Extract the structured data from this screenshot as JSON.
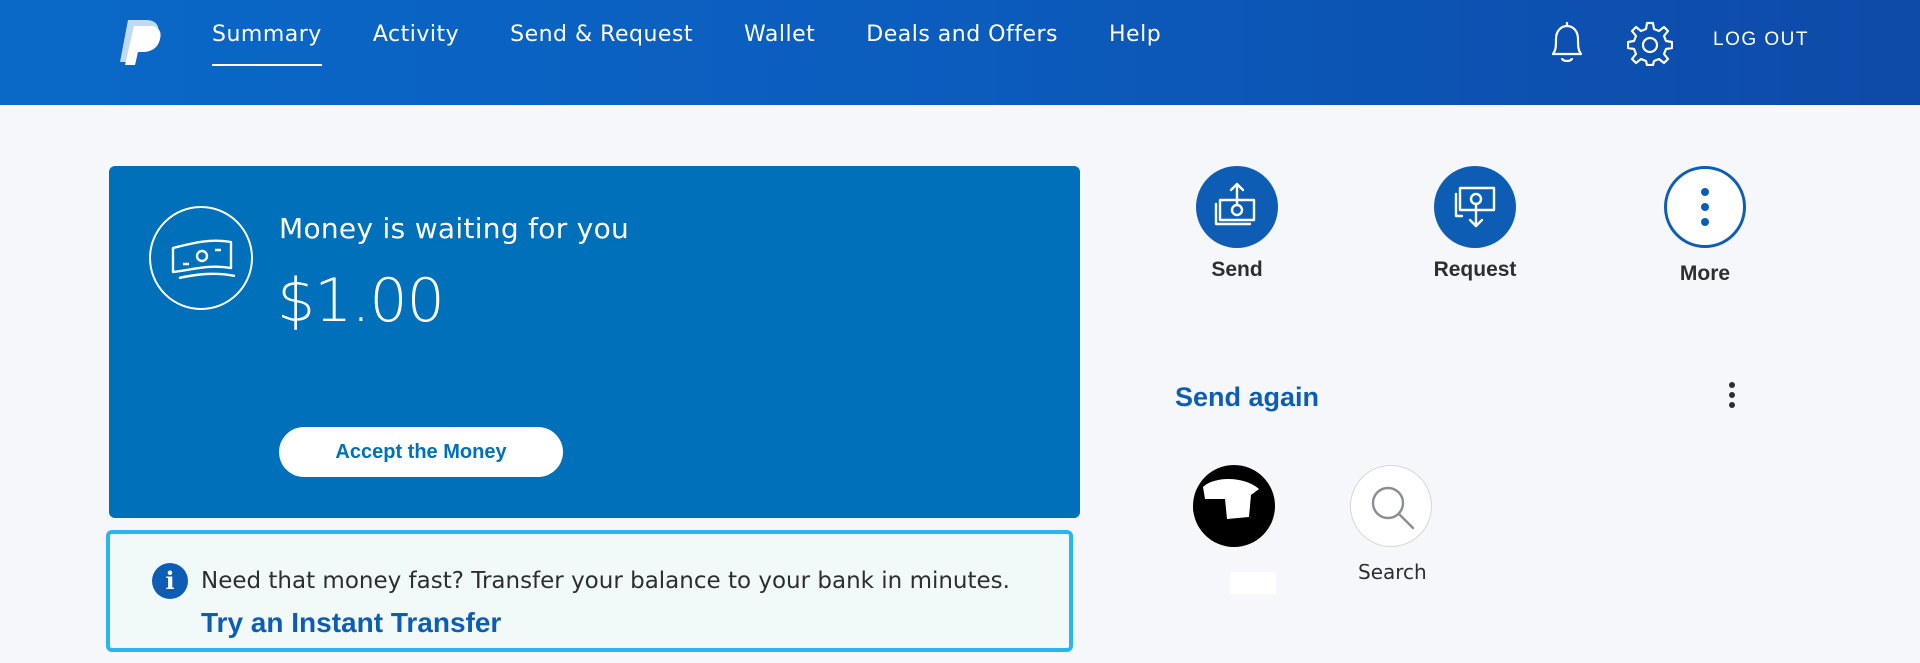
{
  "nav": {
    "items": [
      "Summary",
      "Activity",
      "Send & Request",
      "Wallet",
      "Deals and Offers",
      "Help"
    ],
    "active": "Summary",
    "logout_label": "LOG OUT"
  },
  "money_card": {
    "title": "Money is waiting for you",
    "amount": "$1.00",
    "accept_label": "Accept the Money"
  },
  "info_banner": {
    "message": "Need that money fast? Transfer your balance to your bank in minutes.",
    "link_label": "Try an Instant Transfer"
  },
  "actions": {
    "send_label": "Send",
    "request_label": "Request",
    "more_label": "More"
  },
  "send_again": {
    "title": "Send again",
    "search_label": "Search"
  },
  "icons": {
    "logo": "paypal-logo",
    "notifications": "bell-icon",
    "settings": "gear-icon",
    "money": "cash-icon",
    "info": "info-icon",
    "send": "send-money-icon",
    "request": "request-money-icon",
    "more": "more-vertical-icon",
    "search": "search-icon"
  },
  "colors": {
    "header_blue": "#0a69c7",
    "card_blue": "#0070ba",
    "accent_dark_blue": "#0e5db4",
    "banner_border": "#29b6f0",
    "banner_bg": "#f1faf8",
    "page_bg": "#f5f7fa"
  }
}
